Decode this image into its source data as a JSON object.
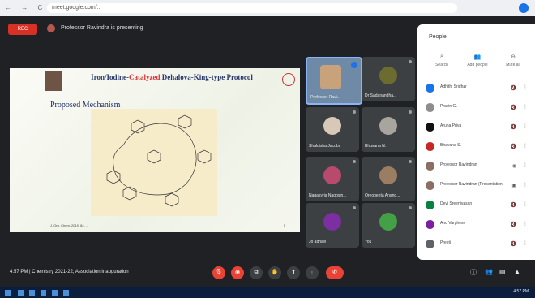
{
  "browser": {
    "nav": "← → C ⌂",
    "url": "meet.google.com/..."
  },
  "meeting": {
    "rec": "REC",
    "presenting": "Professor Ravindra is presenting"
  },
  "slide": {
    "title_a": "Iron/Iodine-",
    "title_red": "Catalyzed",
    "title_b": " Dehalova-King-type Protocol",
    "subtitle": "Proposed Mechanism",
    "footer": "J. Org. Chem. 2019, 84, ..."
  },
  "tiles": [
    {
      "name": "Professor Ravi...",
      "color": "#c8a27a"
    },
    {
      "name": "Dr Sadanandha...",
      "color": "#6d6c30"
    },
    {
      "name": "Shaloisha Jacoba",
      "color": "#d8c8b8"
    },
    {
      "name": "Bhuvana N.",
      "color": "#a8a49e"
    },
    {
      "name": "Nagasyria Nagosin...",
      "color": "#b84a6e"
    },
    {
      "name": "Oreopenta Anand...",
      "color": "#9b7d63"
    },
    {
      "name": "Jo adhavi",
      "color": "#7b2fa0"
    },
    {
      "name": "You",
      "color": "#43a047"
    }
  ],
  "panel": {
    "title": "People",
    "tabs": [
      {
        "icon": "⌕",
        "label": "Search"
      },
      {
        "icon": "👥",
        "label": "Add people"
      },
      {
        "icon": "⊖",
        "label": "Mute all"
      }
    ],
    "people": [
      {
        "name": "Adhithi Sridhar",
        "color": "#1a73e8",
        "mic": "🔇"
      },
      {
        "name": "Pravin G.",
        "color": "#8d8d8d",
        "mic": "🔇"
      },
      {
        "name": "Aruna Priya",
        "color": "#111111",
        "mic": "🔇"
      },
      {
        "name": "Bhavana S.",
        "color": "#c62828",
        "mic": "🔇"
      },
      {
        "name": "Professor Ravindran",
        "color": "#8d6e63",
        "mic": "◉"
      },
      {
        "name": "Professor Ravindran (Presentation)",
        "color": "#8d6e63",
        "mic": "▣"
      },
      {
        "name": "Devi Sreenivasan",
        "color": "#0b8043",
        "mic": "🔇"
      },
      {
        "name": "Anu Varghese",
        "color": "#7b1fa2",
        "mic": "🔇"
      },
      {
        "name": "Preeti",
        "color": "#5f6368",
        "mic": "🔇"
      }
    ]
  },
  "bottom": {
    "info": "4:57 PM | Chemistry 2021-22, Association Inauguration"
  },
  "clock": "4:57 PM"
}
